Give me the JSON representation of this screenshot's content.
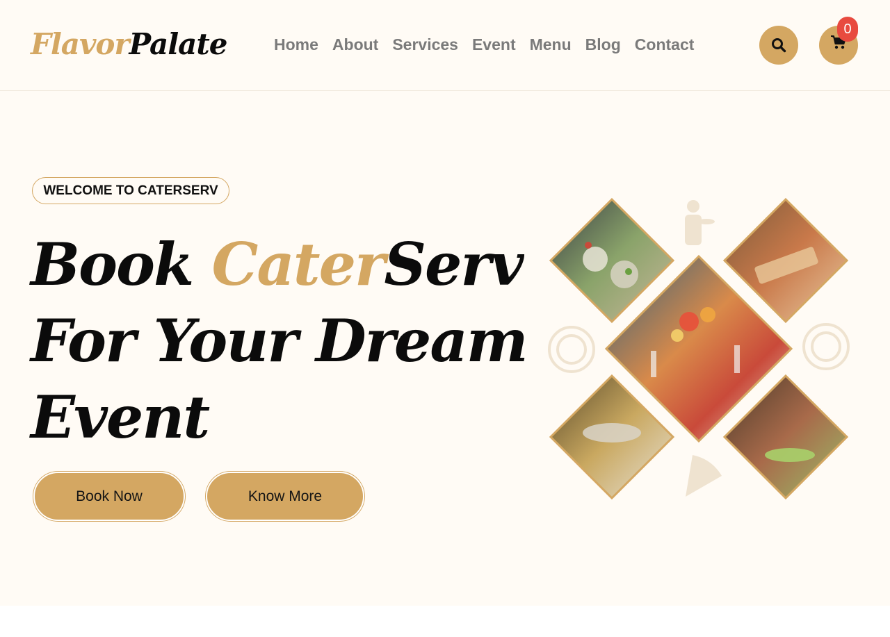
{
  "brand": {
    "logo_part1": "Flavor",
    "logo_part2": "Palate"
  },
  "nav": {
    "items": [
      "Home",
      "About",
      "Services",
      "Event",
      "Menu",
      "Blog",
      "Contact"
    ]
  },
  "header_icons": {
    "search": "search-icon",
    "cart": "cart-icon",
    "cart_count": "0"
  },
  "hero": {
    "tagline": "WELCOME TO CATERSERV",
    "headline_word1": "Book",
    "headline_word2": "Cater",
    "headline_word3": "Serv",
    "headline_line2": "For Your Dream",
    "headline_line3": "Event",
    "primary_button": "Book Now",
    "secondary_button": "Know More"
  },
  "colors": {
    "accent": "#d4a762",
    "background": "#fffbf5",
    "badge": "#e84a3f",
    "nav_text": "#7a7a7a"
  }
}
